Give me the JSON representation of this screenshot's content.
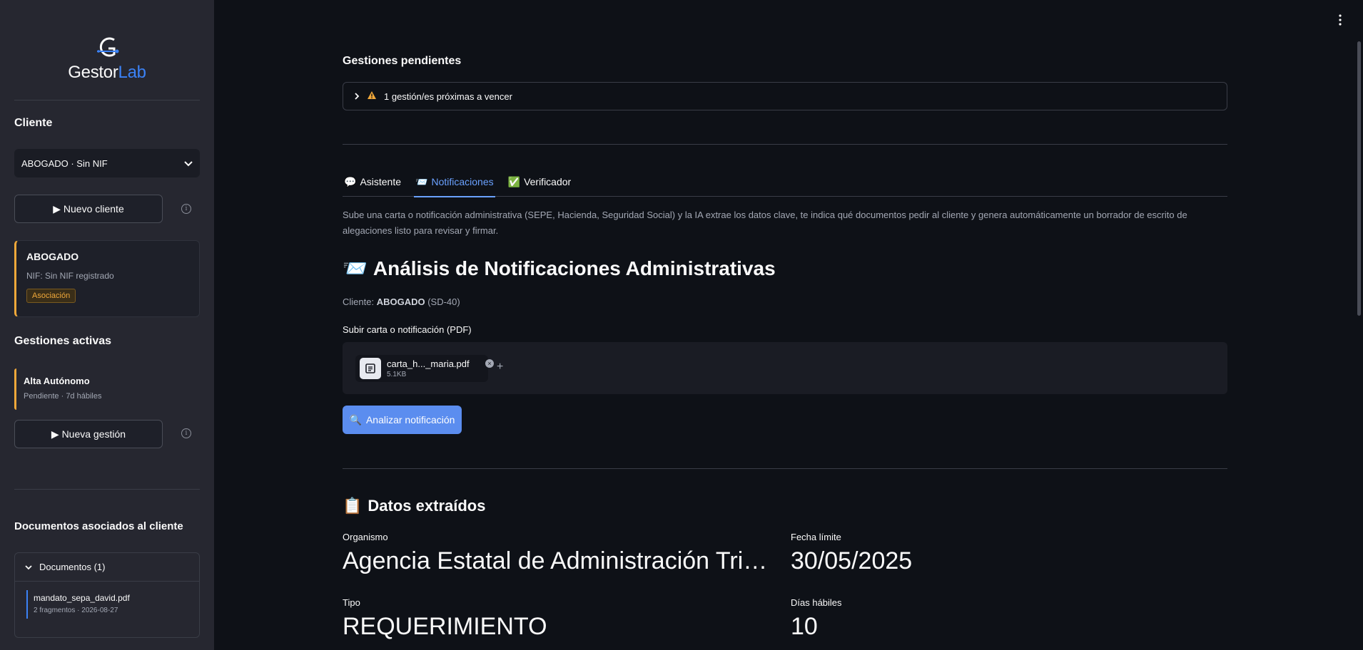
{
  "sidebar": {
    "logo": {
      "part1": "Gestor",
      "part2": "Lab"
    },
    "cliente_heading": "Cliente",
    "client_select": {
      "value": "ABOGADO · Sin NIF"
    },
    "new_client_label": "▶ Nuevo cliente",
    "client_card": {
      "name": "ABOGADO",
      "nif": "NIF: Sin NIF registrado",
      "badge": "Asociación"
    },
    "gestiones_heading": "Gestiones activas",
    "gestion": {
      "title": "Alta Autónomo",
      "status": "Pendiente · 7d hábiles"
    },
    "new_gestion_label": "▶ Nueva gestión",
    "docs_heading": "Documentos asociados al cliente",
    "docs_expander": "Documentos (1)",
    "doc": {
      "name": "mandato_sepa_david.pdf",
      "meta": "2 fragmentos · 2026-08-27"
    }
  },
  "main": {
    "pending_heading": "Gestiones pendientes",
    "pending_expander": "1 gestión/es próximas a vencer",
    "tabs": [
      {
        "icon": "💬",
        "label": "Asistente"
      },
      {
        "icon": "📨",
        "label": "Notificaciones"
      },
      {
        "icon": "✅",
        "label": "Verificador"
      }
    ],
    "description": "Sube una carta o notificación administrativa (SEPE, Hacienda, Seguridad Social) y la IA extrae los datos clave, te indica qué documentos pedir al cliente y genera automáticamente un borrador de escrito de alegaciones listo para revisar y firmar.",
    "title_icon": "📨",
    "title": "Análisis de Notificaciones Administrativas",
    "client_prefix": "Cliente:",
    "client_name": "ABOGADO",
    "client_code": "(SD-40)",
    "upload_label": "Subir carta o notificación (PDF)",
    "file": {
      "name": "carta_h..._maria.pdf",
      "size": "5.1KB"
    },
    "analyze_button": "Analizar notificación",
    "analyze_icon": "🔍",
    "extracted_icon": "📋",
    "extracted_heading": "Datos extraídos",
    "metrics": {
      "organismo_label": "Organismo",
      "organismo_value": "Agencia Estatal de Administración Tributaria",
      "fecha_label": "Fecha límite",
      "fecha_value": "30/05/2025",
      "tipo_label": "Tipo",
      "tipo_value": "REQUERIMIENTO",
      "dias_label": "Días hábiles",
      "dias_value": "10"
    }
  },
  "colors": {
    "accent": "#6aa1ff",
    "primary_button": "#5b8def",
    "warning": "#f0a83a"
  }
}
